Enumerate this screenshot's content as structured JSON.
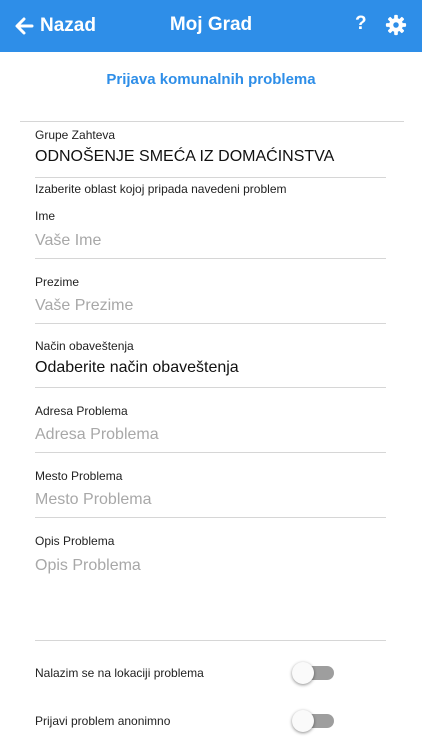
{
  "header": {
    "back_label": "Nazad",
    "title": "Moj Grad",
    "help_label": "?",
    "accent_color": "#2e8ee8"
  },
  "page_title": "Prijava komunalnih problema",
  "form": {
    "group": {
      "label": "Grupe Zahteva",
      "value": "ODNOŠENJE SMEĆA IZ DOMAĆINSTVA"
    },
    "area_hint": "Izaberite oblast kojoj pripada navedeni problem",
    "first_name": {
      "label": "Ime",
      "placeholder": "Vaše Ime"
    },
    "last_name": {
      "label": "Prezime",
      "placeholder": "Vaše Prezime"
    },
    "notification": {
      "label": "Način obaveštenja",
      "value": "Odaberite način obaveštenja"
    },
    "address": {
      "label": "Adresa Problema",
      "placeholder": "Adresa Problema"
    },
    "place": {
      "label": "Mesto Problema",
      "placeholder": "Mesto Problema"
    },
    "description": {
      "label": "Opis Problema",
      "placeholder": "Opis Problema"
    }
  },
  "toggles": {
    "at_location": {
      "label": "Nalazim se na lokaciji problema",
      "on": false
    },
    "anonymous": {
      "label": "Prijavi problem anonimno",
      "on": false
    }
  },
  "icons": {
    "back": "arrow-left-icon",
    "settings": "gear-icon"
  }
}
